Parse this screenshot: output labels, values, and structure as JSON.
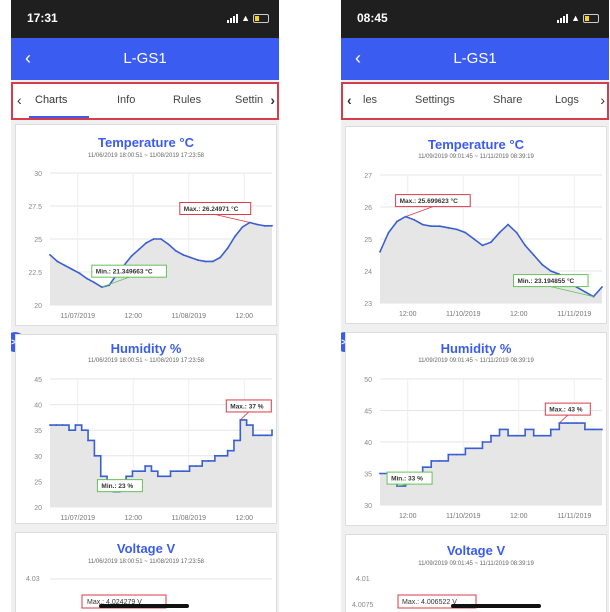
{
  "colors": {
    "accent": "#3b5cf0",
    "highlight": "#d83b4a",
    "line": "#3a5fd0",
    "min_marker": "#66c05a",
    "max_marker": "#d83b4a"
  },
  "left": {
    "status": {
      "time": "17:31"
    },
    "header": {
      "back_icon": "chevron-left-icon",
      "title": "L-GS1"
    },
    "tabs": {
      "prev_icon": "chevron-left-icon",
      "next_icon": "chevron-right-icon",
      "items": [
        "Charts",
        "Info",
        "Rules",
        "Settin"
      ],
      "active": "Charts"
    },
    "fab_icon": "skip-to-end-icon",
    "fab_label": ">I",
    "charts": [
      {
        "title": "Temperature °C",
        "range": "11/06/2019 18:00:51 ~ 11/08/2019 17:23:58",
        "y_ticks": [
          "30",
          "27.5",
          "25",
          "22.5",
          "20"
        ],
        "x_ticks": [
          "11/07/2019",
          "12:00",
          "11/08/2019",
          "12:00"
        ],
        "min_label": "Min.: 21.349663 °C",
        "max_label": "Max.: 26.24971 °C",
        "chart_data": {
          "type": "area",
          "title": "Temperature °C",
          "ylim": [
            20,
            30
          ],
          "x_ticks": [
            "11/07/2019",
            "12:00",
            "11/08/2019",
            "12:00"
          ],
          "series": [
            {
              "values": [
                23.8,
                23.3,
                23.0,
                22.7,
                22.4,
                22.0,
                21.7,
                21.35,
                21.5,
                22.3,
                23.0,
                23.7,
                24.2,
                24.7,
                25.0,
                25.0,
                24.6,
                24.1,
                23.8,
                23.6,
                23.4,
                23.3,
                23.3,
                23.6,
                24.3,
                25.2,
                25.9,
                26.25,
                26.1,
                26.0,
                26.0
              ]
            }
          ],
          "min": 21.349663,
          "max": 26.24971
        }
      },
      {
        "title": "Humidity %",
        "range": "11/06/2019 18:00:51 ~ 11/08/2019 17:23:58",
        "y_ticks": [
          "45",
          "40",
          "35",
          "30",
          "25",
          "20"
        ],
        "x_ticks": [
          "11/07/2019",
          "12:00",
          "11/08/2019",
          "12:00"
        ],
        "min_label": "Min.: 23 %",
        "max_label": "Max.: 37 %",
        "chart_data": {
          "type": "area",
          "title": "Humidity %",
          "ylim": [
            20,
            45
          ],
          "x_ticks": [
            "11/07/2019",
            "12:00",
            "11/08/2019",
            "12:00"
          ],
          "series": [
            {
              "values": [
                36,
                36,
                36,
                35,
                36,
                35,
                33,
                30,
                26,
                24,
                23,
                24,
                26,
                27,
                27,
                28,
                27,
                26,
                26,
                27,
                27,
                27,
                28,
                28,
                29,
                29,
                30,
                30,
                31,
                33,
                37,
                36,
                34,
                34,
                34,
                35
              ]
            }
          ],
          "min": 23,
          "max": 37
        }
      },
      {
        "title": "Voltage V",
        "range": "11/06/2019 18:00:51 ~ 11/08/2019 17:23:58",
        "y_ticks": [
          "4.03"
        ],
        "max_label": "Max.: 4.024279 V"
      }
    ]
  },
  "right": {
    "status": {
      "time": "08:45"
    },
    "header": {
      "back_icon": "chevron-left-icon",
      "title": "L-GS1"
    },
    "tabs": {
      "prev_icon": "chevron-left-icon",
      "next_icon": "chevron-right-icon",
      "items": [
        "les",
        "Settings",
        "Share",
        "Logs"
      ],
      "active": ""
    },
    "fab_icon": "skip-to-end-icon",
    "fab_label": ">I",
    "charts": [
      {
        "title": "Temperature °C",
        "range": "11/09/2019 09:01:45 ~ 11/11/2019 08:39:19",
        "y_ticks": [
          "27",
          "26",
          "25",
          "24",
          "23"
        ],
        "x_ticks": [
          "12:00",
          "11/10/2019",
          "12:00",
          "11/11/2019"
        ],
        "min_label": "Min.: 23.194855 °C",
        "max_label": "Max.: 25.699623 °C",
        "chart_data": {
          "type": "area",
          "title": "Temperature °C",
          "ylim": [
            23,
            27
          ],
          "x_ticks": [
            "12:00",
            "11/10/2019",
            "12:00",
            "11/11/2019"
          ],
          "series": [
            {
              "values": [
                24.6,
                25.2,
                25.55,
                25.7,
                25.6,
                25.45,
                25.4,
                25.4,
                25.35,
                25.3,
                25.2,
                25.0,
                24.8,
                24.9,
                25.2,
                25.45,
                25.2,
                24.8,
                24.5,
                24.2,
                24.0,
                23.9,
                23.7,
                23.5,
                23.35,
                23.2,
                23.5
              ]
            }
          ],
          "min": 23.194855,
          "max": 25.699623
        }
      },
      {
        "title": "Humidity %",
        "range": "11/09/2019 09:01:45 ~ 11/11/2019 08:39:19",
        "y_ticks": [
          "50",
          "45",
          "40",
          "35",
          "30"
        ],
        "x_ticks": [
          "12:00",
          "11/10/2019",
          "12:00",
          "11/11/2019"
        ],
        "min_label": "Min.: 33 %",
        "max_label": "Max.: 43 %",
        "chart_data": {
          "type": "area",
          "title": "Humidity %",
          "ylim": [
            30,
            50
          ],
          "x_ticks": [
            "12:00",
            "11/10/2019",
            "12:00",
            "11/11/2019"
          ],
          "series": [
            {
              "values": [
                35,
                34,
                33,
                34,
                35,
                36,
                37,
                37,
                38,
                38,
                39,
                39,
                40,
                41,
                42,
                41,
                41,
                42,
                41,
                41,
                42,
                43,
                43,
                43,
                42,
                42,
                42
              ]
            }
          ],
          "min": 33,
          "max": 43
        }
      },
      {
        "title": "Voltage V",
        "range": "11/09/2019 09:01:45 ~ 11/11/2019 08:39:19",
        "y_ticks": [
          "4.01",
          "4.0075"
        ],
        "max_label": "Max.: 4.006522 V"
      }
    ]
  }
}
